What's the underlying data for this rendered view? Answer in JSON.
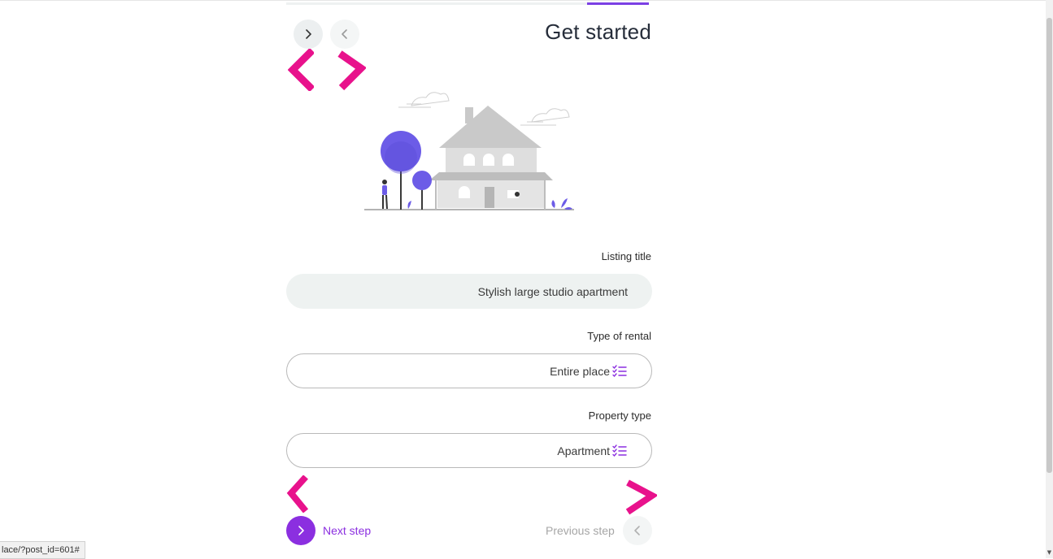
{
  "header": {
    "title": "Get started",
    "progress_fraction": 0.17
  },
  "form": {
    "listing_title": {
      "label": "Listing title",
      "value": "Stylish large studio apartment"
    },
    "type_of_rental": {
      "label": "Type of rental",
      "value": "Entire place"
    },
    "property_type": {
      "label": "Property type",
      "value": "Apartment"
    }
  },
  "footer": {
    "next_label": "Next step",
    "prev_label": "Previous step"
  },
  "status_bar": {
    "url": "lace/?post_id=601#"
  },
  "icons": {
    "nav_next": "chevron-right-icon",
    "nav_prev": "chevron-left-icon",
    "list": "checklist-icon"
  },
  "colors": {
    "accent": "#8b2fe0",
    "annotation": "#e8128c",
    "tree": "#6c5ce7"
  }
}
